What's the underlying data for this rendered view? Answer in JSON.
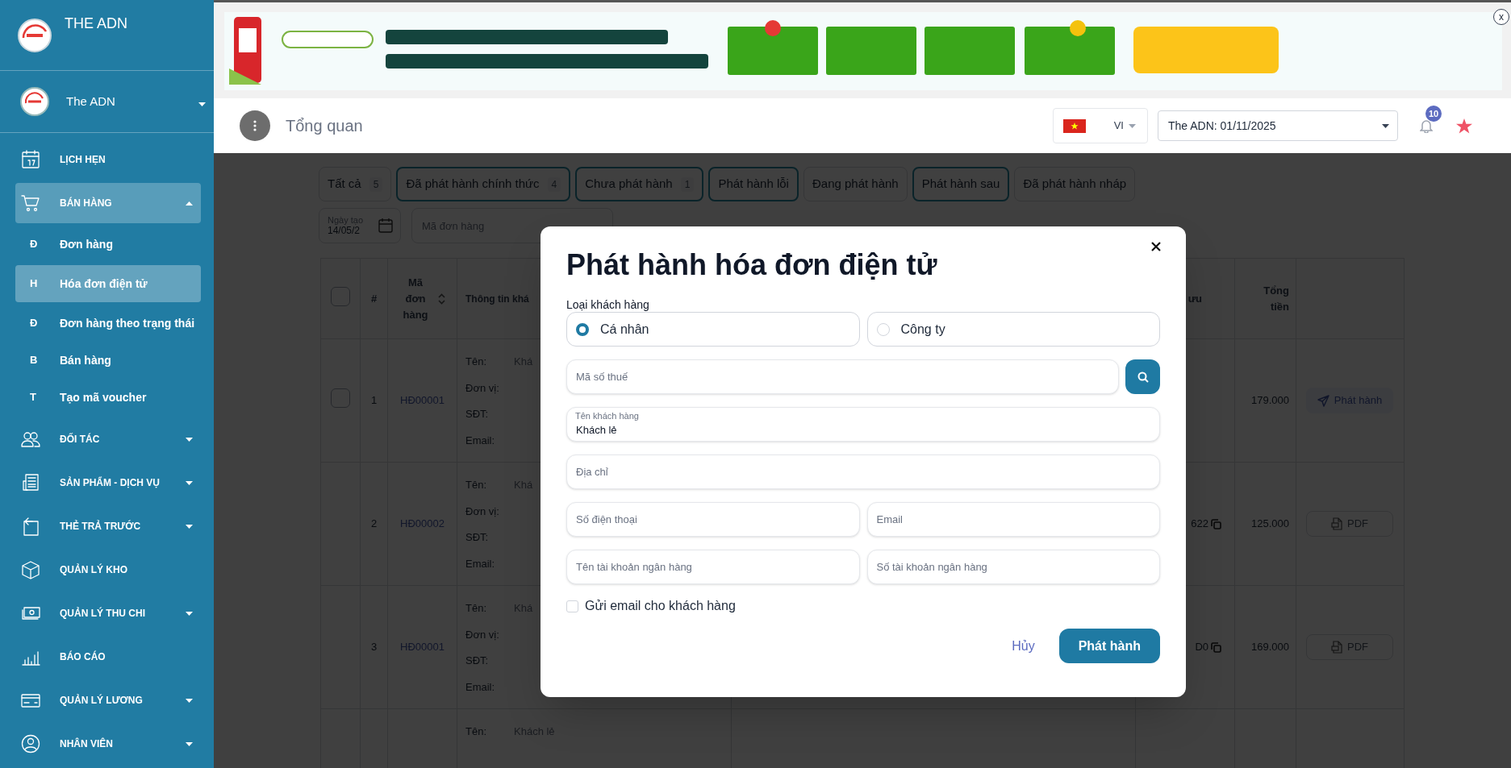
{
  "sidebar": {
    "brand": "THE ADN",
    "user": "The ADN",
    "menu": [
      {
        "kind": "link",
        "label": "LỊCH HẸN",
        "selected": false
      },
      {
        "kind": "group",
        "label": "BÁN HÀNG",
        "selected": true,
        "expanded": true,
        "children": [
          {
            "initial": "Đ",
            "label": "Đơn hàng",
            "selected": false
          },
          {
            "initial": "H",
            "label": "Hóa đơn điện tử",
            "selected": true
          },
          {
            "initial": "Đ",
            "label": "Đơn hàng theo trạng thái",
            "selected": false
          },
          {
            "initial": "B",
            "label": "Bán hàng",
            "selected": false
          },
          {
            "initial": "T",
            "label": "Tạo mã voucher",
            "selected": false
          }
        ]
      },
      {
        "kind": "group",
        "label": "ĐỐI TÁC",
        "selected": false,
        "expanded": false
      },
      {
        "kind": "group",
        "label": "SẢN PHẨM - DỊCH VỤ",
        "selected": false,
        "expanded": false
      },
      {
        "kind": "group",
        "label": "THẺ TRẢ TRƯỚC",
        "selected": false,
        "expanded": false
      },
      {
        "kind": "link",
        "label": "QUẢN LÝ KHO",
        "selected": false
      },
      {
        "kind": "group",
        "label": "QUẢN LÝ THU CHI",
        "selected": false,
        "expanded": false
      },
      {
        "kind": "link",
        "label": "BÁO CÁO",
        "selected": false
      },
      {
        "kind": "group",
        "label": "QUẢN LÝ LƯƠNG",
        "selected": false,
        "expanded": false
      },
      {
        "kind": "group",
        "label": "NHÂN VIÊN",
        "selected": false,
        "expanded": false
      }
    ]
  },
  "banner": {
    "kind": "picture",
    "close_label": "x"
  },
  "header": {
    "title": "Tổng quan",
    "language": "VI",
    "branch_select": "The ADN: 01/11/2025",
    "notification_count": "10"
  },
  "tabs": [
    {
      "label": "Tất cả",
      "count": "5",
      "selected": false
    },
    {
      "label": "Đã phát hành chính thức",
      "count": "4",
      "selected": true
    },
    {
      "label": "Chưa phát hành",
      "count": "1",
      "selected": true
    },
    {
      "label": "Phát hành lỗi",
      "selected": true
    },
    {
      "label": "Đang phát hành",
      "selected": false
    },
    {
      "label": "Phát hành sau",
      "selected": true
    },
    {
      "label": "Đã phát hành nháp",
      "selected": false
    }
  ],
  "filters": {
    "date_label": "Ngày tạo",
    "date_value": "14/05/2",
    "order_placeholder": "Mã đơn hàng"
  },
  "table": {
    "select_all_checked": false,
    "columns": [
      {
        "label": "#",
        "sortable": false
      },
      {
        "label": "Mã đơn hàng",
        "sortable": true
      },
      {
        "label": "Thông tin khá",
        "sortable": false
      },
      {
        "label": "ưu",
        "sortable": false
      },
      {
        "label": "Tổng tiền",
        "sortable": false
      }
    ],
    "rows": [
      {
        "checked": false,
        "number": "1",
        "code": "HĐ00001",
        "info": [
          {
            "label": "Tên:",
            "value": "Khá"
          },
          {
            "label": "Đơn vị:"
          },
          {
            "label": "SĐT:"
          },
          {
            "label": "Email:"
          }
        ],
        "total": "179.000",
        "action": {
          "kind": "issue",
          "label": "Phát hành"
        }
      },
      {
        "number": "2",
        "code": "HĐ00002",
        "info": [
          {
            "label": "Tên:",
            "value": "Khá"
          },
          {
            "label": "Đơn vị:"
          },
          {
            "label": "SĐT:"
          },
          {
            "label": "Email:"
          }
        ],
        "column_4": "622",
        "total": "125.000",
        "action": {
          "kind": "pdf",
          "label": "PDF"
        }
      },
      {
        "number": "3",
        "code": "HĐ00001",
        "info": [
          {
            "label": "Tên:",
            "value": "Khá"
          },
          {
            "label": "Đơn vị:"
          },
          {
            "label": "SĐT:"
          },
          {
            "label": "Email:"
          }
        ],
        "column_4": "D0",
        "total": "169.000",
        "action": {
          "kind": "pdf",
          "label": "PDF"
        }
      },
      {
        "info": [
          {
            "label": "Tên:",
            "value": "Khách lẻ"
          }
        ]
      }
    ]
  },
  "modal": {
    "title": "Phát hành hóa đơn điện tử",
    "customer_type_label": "Loại khách hàng",
    "customer_types": [
      {
        "label": "Cá nhân",
        "selected": true
      },
      {
        "label": "Công ty",
        "selected": false
      }
    ],
    "tax_placeholder": "Mã số thuế",
    "fields": [
      {
        "kind": "floating",
        "label": "Tên khách hàng",
        "value": "Khách lẻ"
      },
      {
        "kind": "full",
        "placeholder": "Địa chỉ"
      },
      {
        "kind": "half",
        "placeholder": "Số điện thoại"
      },
      {
        "kind": "half",
        "placeholder": "Email"
      },
      {
        "kind": "half",
        "placeholder": "Tên tài khoản ngân hàng"
      },
      {
        "kind": "half",
        "placeholder": "Số tài khoản ngân hàng"
      }
    ],
    "send_email": {
      "label": "Gửi email cho khách hàng",
      "checked": false
    },
    "cancel": "Hủy",
    "submit": "Phát hành"
  }
}
